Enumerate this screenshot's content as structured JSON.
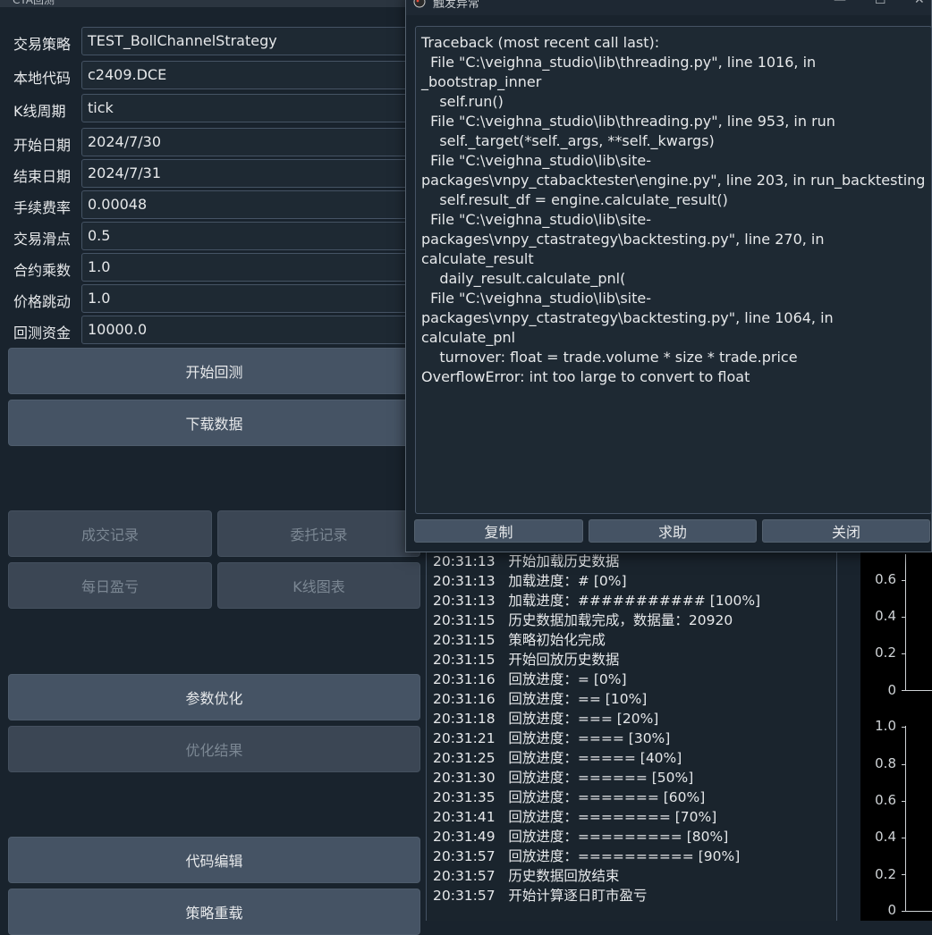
{
  "main_window": {
    "title": "CTA回测"
  },
  "form": {
    "fields": [
      {
        "label": "交易策略",
        "value": "TEST_BollChannelStrategy"
      },
      {
        "label": "本地代码",
        "value": "c2409.DCE"
      },
      {
        "label": "K线周期",
        "value": "tick"
      },
      {
        "label": "开始日期",
        "value": "2024/7/30"
      },
      {
        "label": "结束日期",
        "value": "2024/7/31"
      },
      {
        "label": "手续费率",
        "value": "0.00048"
      },
      {
        "label": "交易滑点",
        "value": "0.5"
      },
      {
        "label": "合约乘数",
        "value": "1.0"
      },
      {
        "label": "价格跳动",
        "value": "1.0"
      },
      {
        "label": "回测资金",
        "value": "10000.0"
      }
    ]
  },
  "buttons": {
    "start_backtest": "开始回测",
    "download_data": "下载数据",
    "trade_records": "成交记录",
    "order_records": "委托记录",
    "daily_pnl": "每日盈亏",
    "kline_chart": "K线图表",
    "param_optimize": "参数优化",
    "optimize_result": "优化结果",
    "code_edit": "代码编辑",
    "strategy_reload": "策略重载"
  },
  "log": {
    "lines": [
      {
        "time": "20:31:13",
        "msg": "开始加载历史数据"
      },
      {
        "time": "20:31:13",
        "msg": "加载进度：# [0%]"
      },
      {
        "time": "20:31:13",
        "msg": "加载进度：########### [100%]"
      },
      {
        "time": "20:31:15",
        "msg": "历史数据加载完成，数据量：20920"
      },
      {
        "time": "20:31:15",
        "msg": "策略初始化完成"
      },
      {
        "time": "20:31:15",
        "msg": "开始回放历史数据"
      },
      {
        "time": "20:31:16",
        "msg": "回放进度：= [0%]"
      },
      {
        "time": "20:31:16",
        "msg": "回放进度：== [10%]"
      },
      {
        "time": "20:31:18",
        "msg": "回放进度：=== [20%]"
      },
      {
        "time": "20:31:21",
        "msg": "回放进度：==== [30%]"
      },
      {
        "time": "20:31:25",
        "msg": "回放进度：===== [40%]"
      },
      {
        "time": "20:31:30",
        "msg": "回放进度：====== [50%]"
      },
      {
        "time": "20:31:35",
        "msg": "回放进度：======= [60%]"
      },
      {
        "time": "20:31:41",
        "msg": "回放进度：======== [70%]"
      },
      {
        "time": "20:31:49",
        "msg": "回放进度：========= [80%]"
      },
      {
        "time": "20:31:57",
        "msg": "回放进度：========== [90%]"
      },
      {
        "time": "20:31:57",
        "msg": "历史数据回放结束"
      },
      {
        "time": "20:31:57",
        "msg": "开始计算逐日盯市盈亏"
      }
    ]
  },
  "chart_axes": {
    "upper": [
      "0.6",
      "0.4",
      "0.2",
      "0"
    ],
    "lower": [
      "1.0",
      "0.8",
      "0.6",
      "0.4",
      "0.2",
      "0"
    ]
  },
  "dialog": {
    "title": "触发异常",
    "traceback": "Traceback (most recent call last):\n  File \"C:\\veighna_studio\\lib\\threading.py\", line 1016, in _bootstrap_inner\n    self.run()\n  File \"C:\\veighna_studio\\lib\\threading.py\", line 953, in run\n    self._target(*self._args, **self._kwargs)\n  File \"C:\\veighna_studio\\lib\\site-\npackages\\vnpy_ctabacktester\\engine.py\", line 203, in run_backtesting\n    self.result_df = engine.calculate_result()\n  File \"C:\\veighna_studio\\lib\\site-\npackages\\vnpy_ctastrategy\\backtesting.py\", line 270, in calculate_result\n    daily_result.calculate_pnl(\n  File \"C:\\veighna_studio\\lib\\site-\npackages\\vnpy_ctastrategy\\backtesting.py\", line 1064, in calculate_pnl\n    turnover: float = trade.volume * size * trade.price\nOverflowError: int too large to convert to float",
    "buttons": {
      "copy": "复制",
      "help": "求助",
      "close": "关闭"
    }
  }
}
